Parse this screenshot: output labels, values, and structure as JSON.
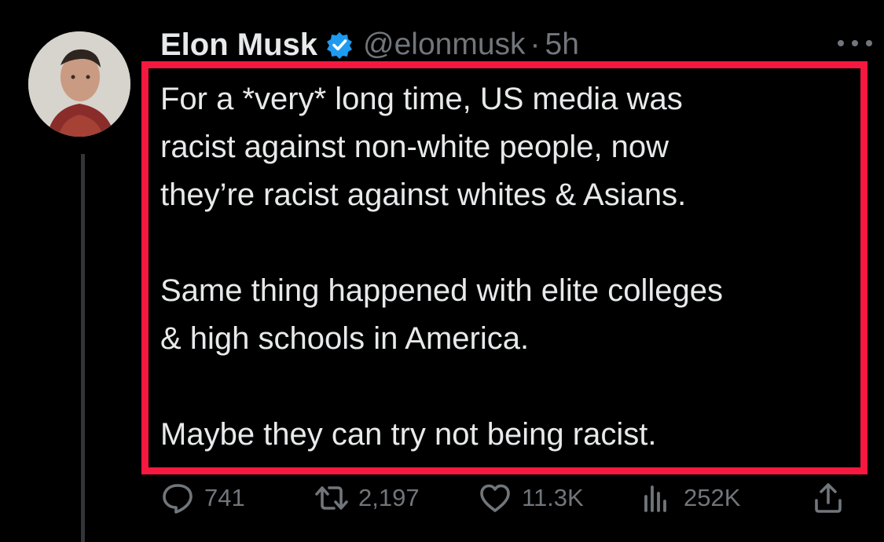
{
  "tweet": {
    "display_name": "Elon Musk",
    "handle": "@elonmusk",
    "separator": "·",
    "time": "5h",
    "text_paragraphs": [
      [
        "For a *very* long time, US media was",
        "racist against non-white people, now",
        "they’re racist against whites & Asians."
      ],
      [
        "Same thing happened with elite colleges",
        "& high schools in America."
      ],
      [
        "Maybe they can try not being racist."
      ]
    ],
    "stats": {
      "replies": "741",
      "reposts": "2,197",
      "likes": "11.3K",
      "views": "252K"
    }
  },
  "icons": {
    "verified": "verified-badge-icon",
    "more": "more-options-icon",
    "reply": "reply-icon",
    "repost": "repost-icon",
    "like": "heart-icon",
    "views": "views-bar-chart-icon",
    "share": "share-icon"
  },
  "colors": {
    "background": "#000000",
    "text": "#e7e9ea",
    "secondary": "#71767b",
    "verified": "#1d9bf0",
    "highlight_border": "#f5183f"
  }
}
